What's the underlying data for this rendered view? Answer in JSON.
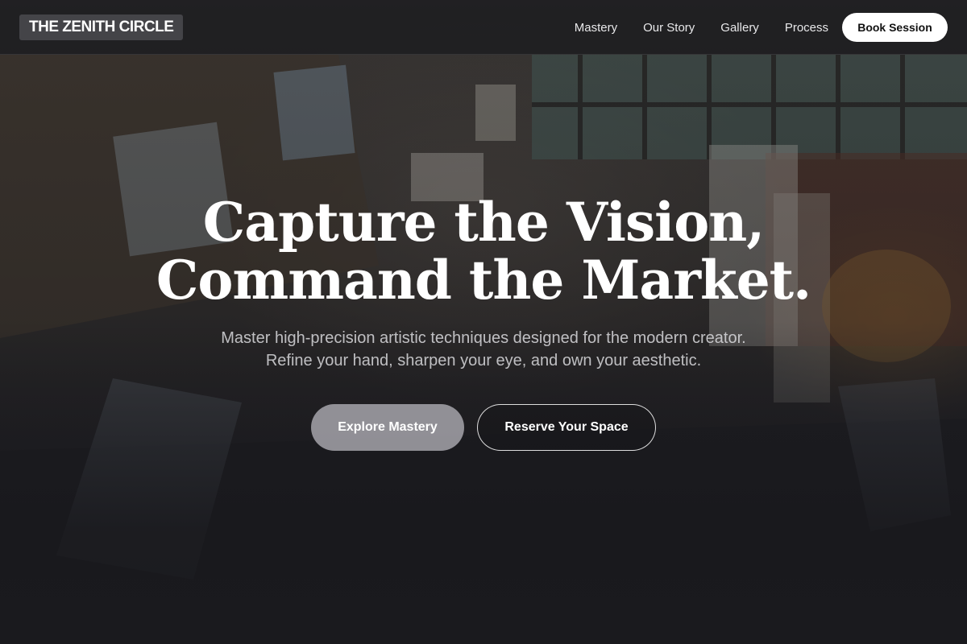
{
  "brand": {
    "name": "THE ZENITH CIRCLE"
  },
  "nav": {
    "links": [
      {
        "label": "Mastery"
      },
      {
        "label": "Our Story"
      },
      {
        "label": "Gallery"
      },
      {
        "label": "Process"
      }
    ],
    "cta_label": "Book Session"
  },
  "hero": {
    "headline_line1": "Capture the Vision,",
    "headline_line2": "Command the Market.",
    "subtitle": "Master high-precision artistic techniques designed for the modern creator. Refine your hand, sharpen your eye, and own your aesthetic.",
    "primary_cta": "Explore Mastery",
    "secondary_cta": "Reserve Your Space",
    "background_image": "art-studio-photo"
  },
  "colors": {
    "nav_background": "#1c1c20",
    "book_button_bg": "#ffffff",
    "primary_cta_bg": "#bebcc4",
    "page_background": "#1a1a1e"
  }
}
